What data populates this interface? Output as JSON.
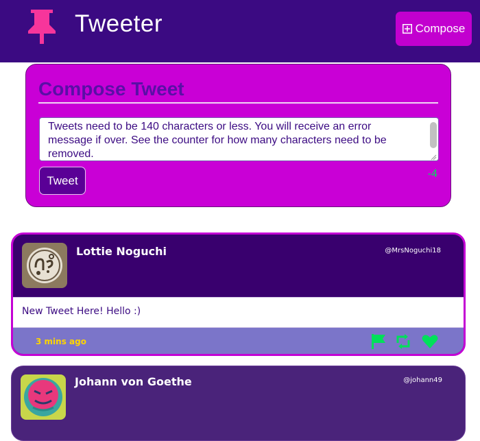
{
  "header": {
    "app_title": "Tweeter",
    "logo_icon": "pushpin-icon",
    "compose_label": "Compose",
    "compose_icon": "plus-square-icon"
  },
  "compose": {
    "heading": "Compose Tweet",
    "textarea_value": "Tweets need to be 140 characters or less. You will receive an error message if over. See the counter for how many characters need to be removed.",
    "submit_label": "Tweet",
    "char_counter": "-4"
  },
  "tweets": [
    {
      "author": "Lottie Noguchi",
      "handle": "@MrsNoguchi18",
      "text": "New Tweet Here! Hello :)",
      "timestamp": "3 mins ago",
      "actions": [
        "flag-icon",
        "retweet-icon",
        "heart-icon"
      ]
    },
    {
      "author": "Johann von Goethe",
      "handle": "@johann49"
    }
  ],
  "colors": {
    "header_bg": "#3b0a82",
    "accent": "#c900d6",
    "action_green": "#00e05a",
    "timestamp_yellow": "#ffd500",
    "footer_bg": "#7b75c9"
  }
}
